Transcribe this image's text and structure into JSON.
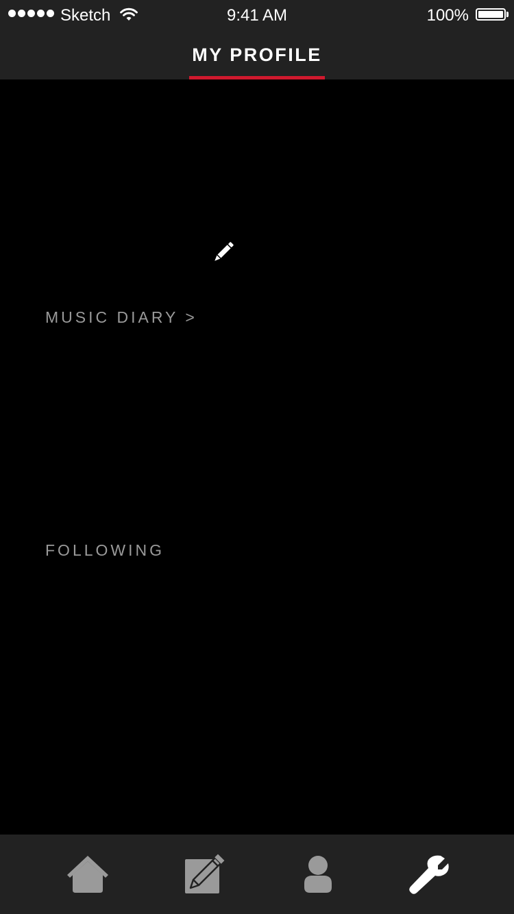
{
  "status_bar": {
    "carrier": "Sketch",
    "time": "9:41 AM",
    "battery": "100%",
    "battery_level": 1.0,
    "signal_bars": 5
  },
  "header": {
    "title": "MY PROFILE",
    "accent_color": "#d0192e"
  },
  "profile": {
    "edit_icon": "pencil-icon",
    "music_diary_label": "MUSIC DIARY >",
    "following_label": "FOLLOWING"
  },
  "tab_bar": {
    "tabs": [
      {
        "icon": "home-icon",
        "active": false
      },
      {
        "icon": "compose-icon",
        "active": false
      },
      {
        "icon": "user-icon",
        "active": false
      },
      {
        "icon": "wrench-icon",
        "active": true
      }
    ],
    "inactive_color": "#9a9a9a",
    "active_color": "#ffffff"
  }
}
